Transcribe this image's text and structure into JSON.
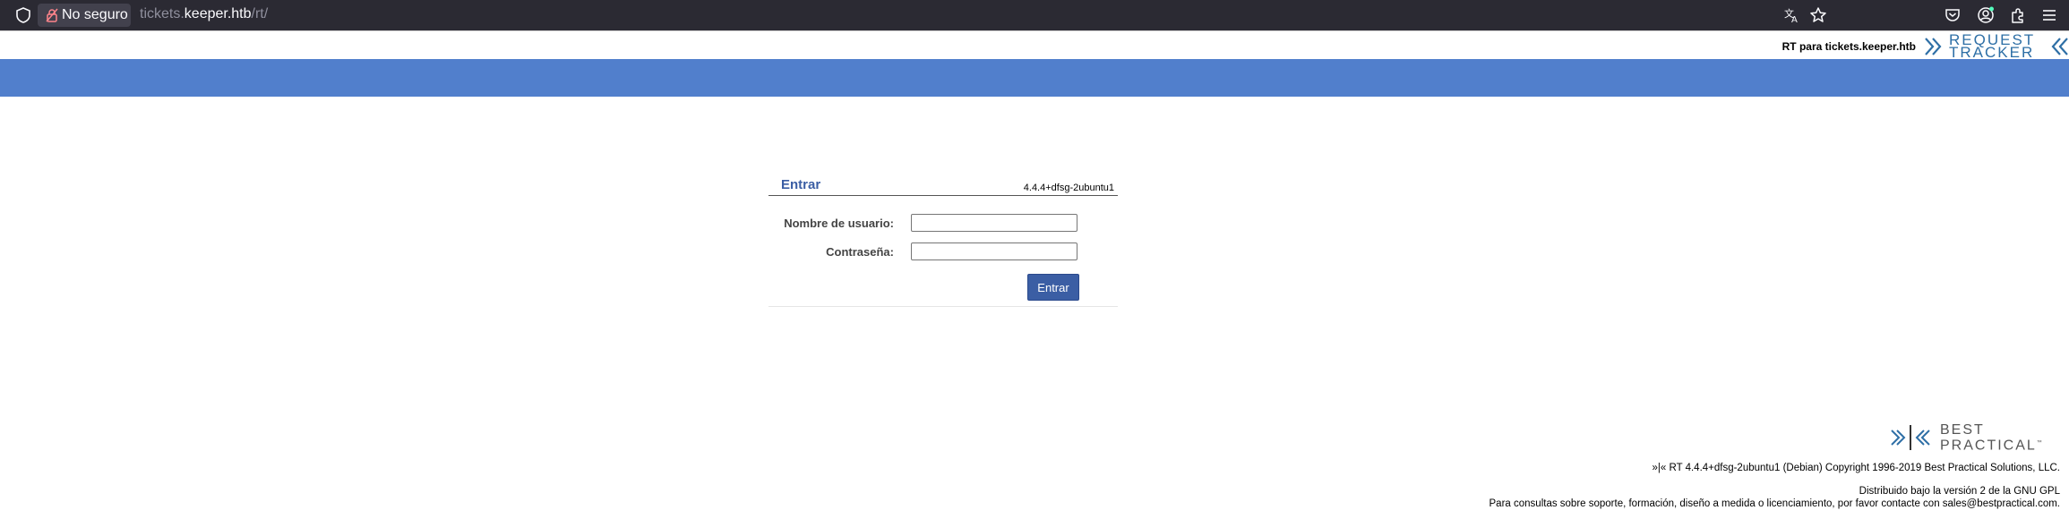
{
  "browser": {
    "security_label": "No seguro",
    "url_subdomain": "tickets.",
    "url_host": "keeper.htb",
    "url_path": "/rt/"
  },
  "header": {
    "site_title": "RT para tickets.keeper.htb",
    "logo_line1": "REQUEST",
    "logo_line2": "TRACKER",
    "logo_color": "#2e6fa6",
    "bar_color": "#517fcc"
  },
  "login": {
    "title": "Entrar",
    "version": "4.4.4+dfsg-2ubuntu1",
    "username_label": "Nombre de usuario:",
    "username_value": "",
    "password_label": "Contraseña:",
    "password_value": "",
    "submit_label": "Entrar",
    "accent_color": "#3b5ea4"
  },
  "footer": {
    "logo_line1": "BEST",
    "logo_line2": "PRACTICAL",
    "logo_mark": "™",
    "copyright_marker": "»|«",
    "copyright": "RT 4.4.4+dfsg-2ubuntu1 (Debian) Copyright 1996-2019 Best Practical Solutions, LLC.",
    "license": "Distribuido bajo la versión 2 de la GNU GPL",
    "contact": "Para consultas sobre soporte, formación, diseño a medida o licenciamiento, por favor contacte con sales@bestpractical.com."
  }
}
